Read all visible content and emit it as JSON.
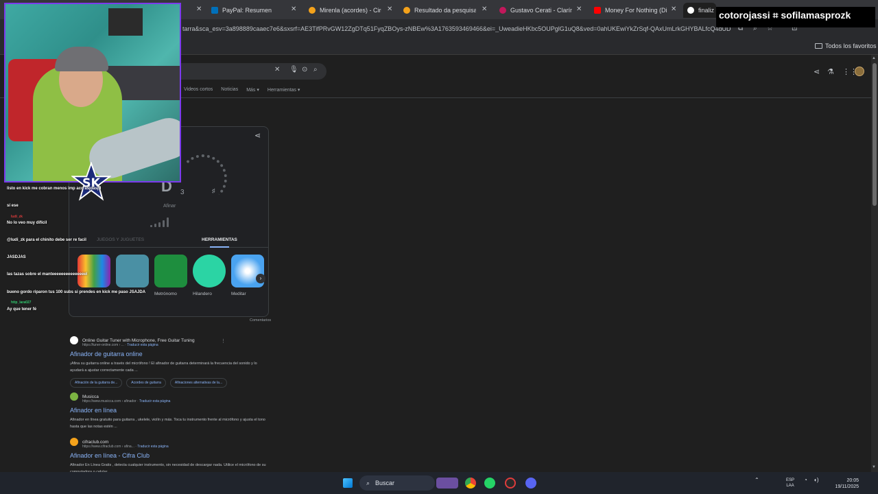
{
  "browser": {
    "tabs": [
      {
        "title": "PayPal: Resumen",
        "fav_color": "#0070ba"
      },
      {
        "title": "Mirenla (acordes) - Ciro y",
        "fav_color": "#f4a21b"
      },
      {
        "title": "Resultado da pesquisa",
        "fav_color": "#f4a21b"
      },
      {
        "title": "Gustavo Cerati - Clarín.co",
        "fav_color": "#c2185b"
      },
      {
        "title": "Money For Nothing (Dire",
        "fav_color": "#ff0000"
      },
      {
        "title": "finaliz",
        "fav_color": "#ffffff"
      }
    ],
    "url": "tarra&sca_esv=3a898889caaec7e6&sxsrf=AE3TifPRvGW12ZgDTq51FyqZBOys-zNBEw%3A1763593469466&ei=_UweadieHKbc5OUPglG1uQ8&ved=0ahUKEwiYkZrSqf-QAxUmLrkGHYBALfcQ4dUD",
    "bookmarks_folder": "Todos los favoritos"
  },
  "google": {
    "filters": [
      "Videos cortos",
      "Noticias",
      "Más",
      "Herramientas"
    ],
    "tuner": {
      "note": "D",
      "octave": "3",
      "sharp": "♯",
      "tune_label": "Afinar",
      "tab_games": "JUEGOS Y JUGUETES",
      "tab_tools": "HERRAMIENTAS",
      "tools": [
        {
          "label": "",
          "color": "#e8eaed"
        },
        {
          "label": "",
          "color": "#4a90a4"
        },
        {
          "label": "Metrónomo",
          "color": "#1e8e3e"
        },
        {
          "label": "Hilandero",
          "color": "#2bd4a4"
        },
        {
          "label": "Meditar",
          "color": "#4aa3f0"
        }
      ],
      "comments": "Comentarios"
    },
    "results": [
      {
        "site": "Online Guitar Tuner with Microphone, Free Guitar Tuning",
        "cite": "https://tuner-online.com › ...",
        "translate": "Traducir esta página",
        "title": "Afinador de guitarra online",
        "snippet": "¡Afina su guitarra online a través del micrófono ! El afinador de guitarra determinará la frecuencia del sonido y lo ayudará a ajustar correctamente cada ...",
        "chips": [
          "Afinación de la guitarra de...",
          "Acordes de guitarra",
          "Afinaciones alternativas de la..."
        ],
        "fav_color": "#ffffff"
      },
      {
        "site": "Musicca",
        "cite": "https://www.musicca.com › afinador",
        "translate": "Traducir esta página",
        "title": "Afinador en línea",
        "snippet": "Afinador en línea gratuito para guitarra , ukelele, violín y más. Toca tu instrumento frente al micrófono y ajusta el tono hasta que las notas estén ...",
        "chips": [],
        "fav_color": "#7cb342"
      },
      {
        "site": "cifraclub.com",
        "cite": "https://www.cifraclub.com › afina...",
        "translate": "Traducir esta página",
        "title": "Afinador en línea - Cifra Club",
        "snippet": "Afinador En Línea Gratis , detecta cualquier instrumento, sin necesidad de descargar nada. Utilice el micrófono de su computadora o celular.",
        "chips": [],
        "fav_color": "#f4a21b"
      }
    ]
  },
  "overlay": {
    "channel_text": "cotorojassi ⌗ sofilamasprozk",
    "chat": [
      {
        "user": "",
        "text": "listo en kick me cobran menos imp          aco asjdasjd"
      },
      {
        "user": "",
        "text": "sí ese"
      },
      {
        "user": "ludi_zk",
        "text": "No lo veo muy difícil"
      },
      {
        "user": "",
        "text": "@ludi_zk para el chinito debe ser re facil"
      },
      {
        "user": "",
        "text": "JASDJAS"
      },
      {
        "user": "",
        "text": "las tazas sobre el manteeeeeeeeeeeeeeel"
      },
      {
        "user": "",
        "text": "bueno gordo riparon tus 100 subs si prendes en kick me paso JSAJDA"
      },
      {
        "user": "http_lara027",
        "text": "Ay que tener fé"
      }
    ]
  },
  "taskbar": {
    "search_label": "Buscar",
    "lang": "ESP",
    "lang2": "LAA",
    "time": "20:05",
    "date": "19/11/2025"
  }
}
